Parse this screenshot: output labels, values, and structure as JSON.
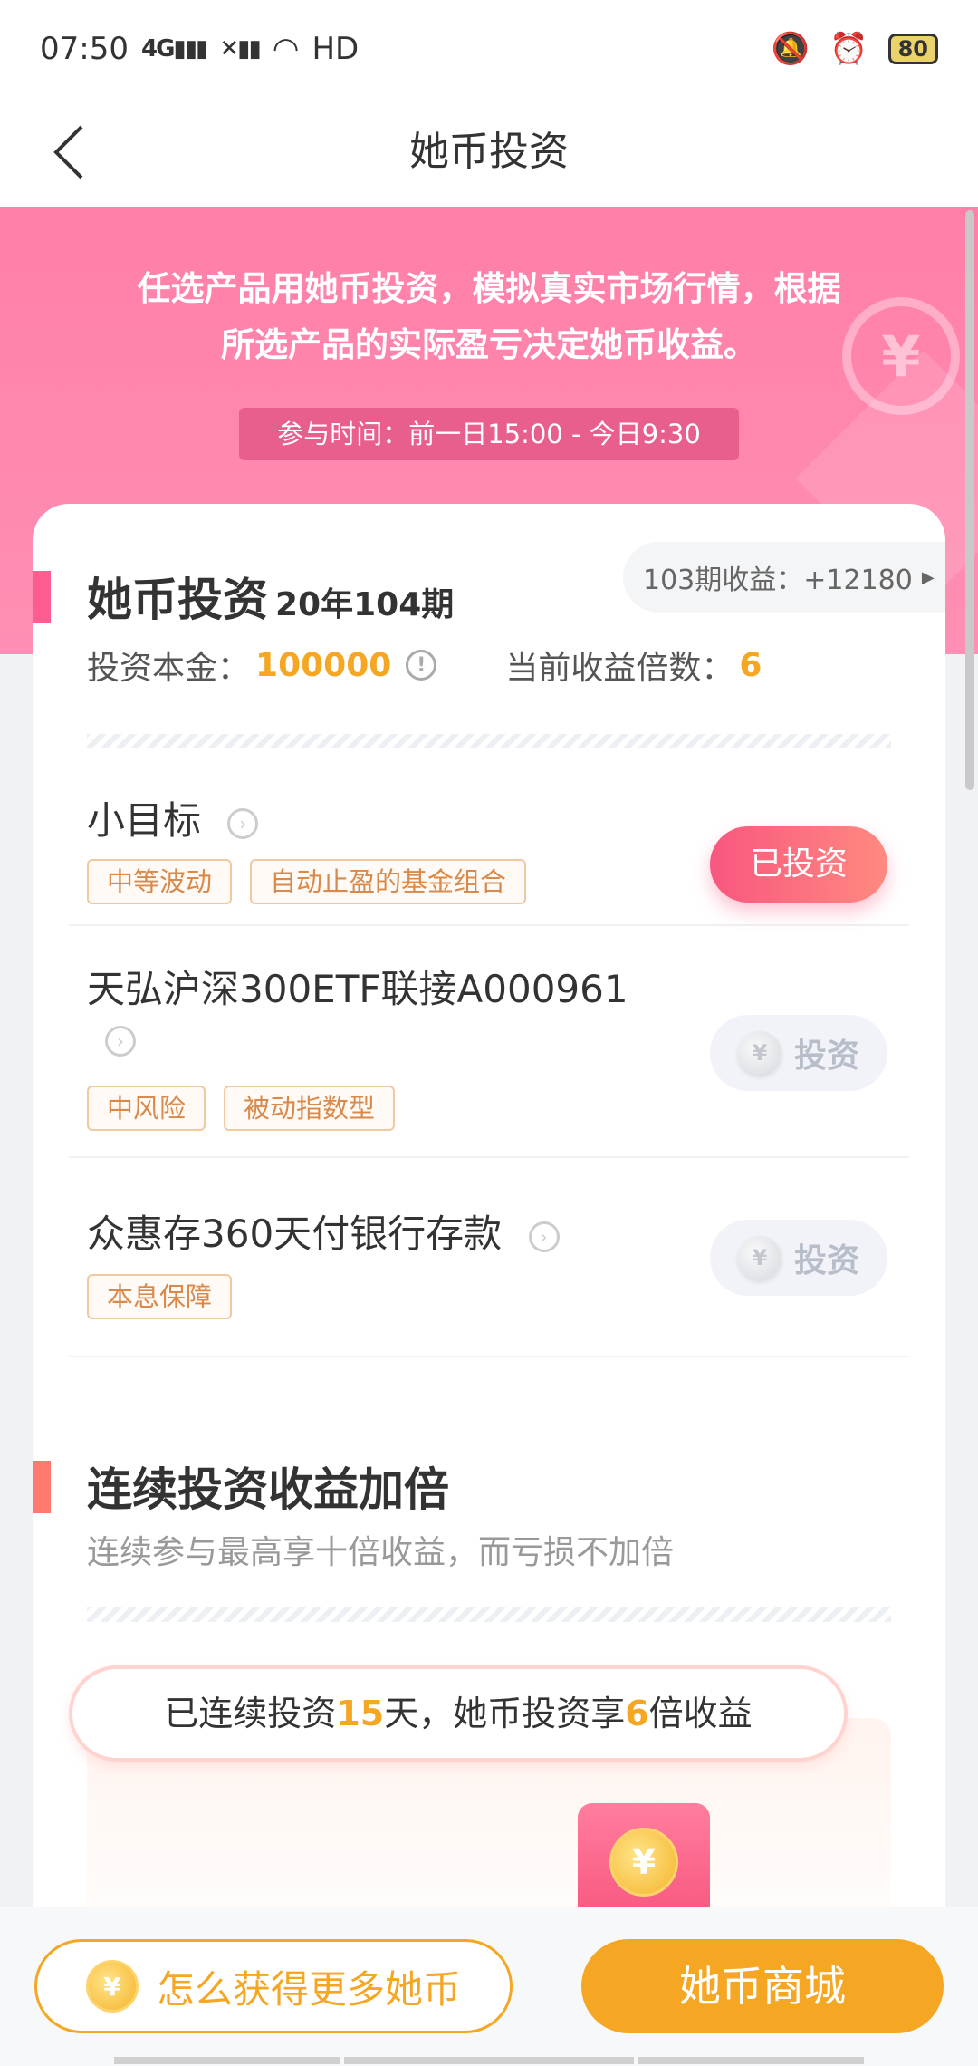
{
  "status": {
    "time": "07:50",
    "net1": "4G",
    "net2": "HD",
    "battery": "80"
  },
  "nav": {
    "title": "她币投资"
  },
  "hero": {
    "description_line1": "任选产品用她币投资，模拟真实市场行情，根据",
    "description_line2": "所选产品的实际盈亏决定她币收益。",
    "time_window": "参与时间：前一日15:00 - 今日9:30"
  },
  "invest": {
    "title": "她币投资",
    "period": "20年104期",
    "last_income": "103期收益：+12180",
    "principal_label": "投资本金：",
    "principal_value": "100000",
    "multiplier_label": "当前收益倍数：",
    "multiplier_value": "6"
  },
  "products": [
    {
      "name": "小目标",
      "tags": [
        "中等波动",
        "自动止盈的基金组合"
      ],
      "action": "已投资"
    },
    {
      "name": "天弘沪深300ETF联接A000961",
      "tags": [
        "中风险",
        "被动指数型"
      ],
      "action": "投资"
    },
    {
      "name": "众惠存360天付银行存款",
      "tags": [
        "本息保障"
      ],
      "action": "投资"
    }
  ],
  "streak": {
    "title": "连续投资收益加倍",
    "subtitle": "连续参与最高享十倍收益，而亏损不加倍",
    "prefix": "已连续投资",
    "days": "15",
    "middle": "天，她币投资享",
    "multiplier": "6",
    "suffix": "倍收益"
  },
  "bottom": {
    "more_label": "怎么获得更多她币",
    "mall_label": "她币商城"
  },
  "icons": {
    "coin": "¥"
  },
  "colors": {
    "accent_pink": "#ff5d8f",
    "accent_orange": "#f5a623",
    "hero_pink": "#ff7fa7"
  }
}
